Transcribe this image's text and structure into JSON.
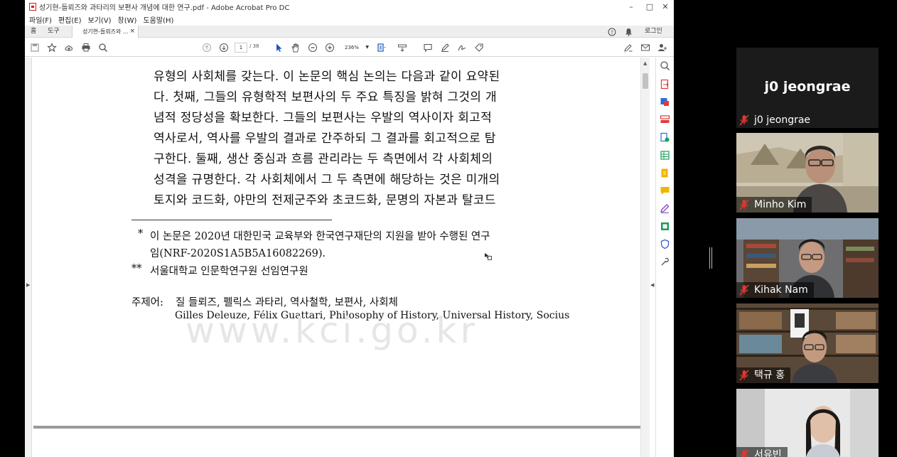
{
  "acrobat": {
    "title": "성기현-들뢰즈와 과타리의 보편사 개념에 대한 연구.pdf - Adobe Acrobat Pro DC",
    "window_controls": [
      "–",
      "□",
      "✕"
    ],
    "menu": [
      "파일(F)",
      "편집(E)",
      "보기(V)",
      "창(W)",
      "도움말(H)"
    ],
    "tabs": {
      "home": "홈",
      "tools": "도구",
      "doc": "성기현-들뢰즈와 ...",
      "close": "×"
    },
    "header_right": {
      "login": "로그인"
    },
    "toolbar": {
      "page_current": "1",
      "page_total": "/ 38",
      "zoom": "236%"
    },
    "document": {
      "body_lines": [
        "유형의 사회체를 갖는다. 이 논문의 핵심 논의는 다음과 같이 요약된",
        "다. 첫째, 그들의 유형학적 보편사의 두 주요 특징을 밝혀 그것의 개",
        "념적 정당성을 확보한다. 그들의 보편사는 우발의 역사이자 회고적",
        "역사로서, 역사를 우발의 결과로 간주하되 그 결과를 회고적으로 탐",
        "구한다. 둘째, 생산 중심과 흐름 관리라는 두 측면에서 각 사회체의",
        "성격을 규명한다. 각 사회체에서 그 두 측면에 해당하는 것은 미개의",
        "토지와 코드화, 야만의 전제군주와 초코드화, 문명의 자본과 탈코드"
      ],
      "footnote1_mark": "*",
      "footnote1_line1": "이 논문은 2020년 대한민국 교육부와 한국연구재단의 지원을 받아 수행된 연구",
      "footnote1_line2": "임(NRF-2020S1A5B5A16082269).",
      "footnote2_mark": "**",
      "footnote2_text": "서울대학교 인문학연구원 선임연구원",
      "keywords_label": "주제어:",
      "keywords_ko": "질 들뢰즈, 펠릭스 과타리, 역사철학, 보편사, 사회체",
      "keywords_en": "Gilles Deleuze, Félix Guattari, Philosophy of History, Universal History, Socius",
      "watermark": "www.kci.go.kr"
    }
  },
  "zoom": {
    "host_big_name": "j0 jeongrae",
    "participants": [
      {
        "name": "j0 jeongrae"
      },
      {
        "name": "Minho Kim"
      },
      {
        "name": "Kihak Nam"
      },
      {
        "name": "택규 홍"
      },
      {
        "name": "서유빈"
      }
    ],
    "colors": {
      "muted_mic": "#e5352b"
    }
  }
}
